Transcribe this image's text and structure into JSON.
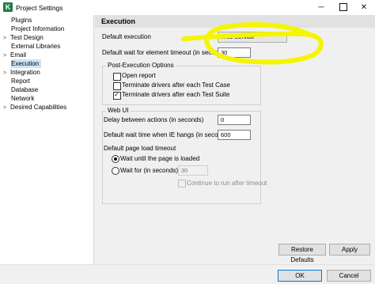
{
  "window": {
    "title": "Project Settings"
  },
  "sidebar": {
    "items": [
      {
        "label": "Plugins"
      },
      {
        "label": "Project Information"
      },
      {
        "label": "Test Design"
      },
      {
        "label": "External Libraries"
      },
      {
        "label": "Email"
      },
      {
        "label": "Execution"
      },
      {
        "label": "Integration"
      },
      {
        "label": "Report"
      },
      {
        "label": "Database"
      },
      {
        "label": "Network"
      },
      {
        "label": "Desired Capabilities"
      }
    ]
  },
  "execution": {
    "title": "Execution",
    "default_execution_label": "Default execution",
    "default_execution_value": "Web Service",
    "default_wait_label": "Default wait for element timeout (in seconds)",
    "default_wait_value": "30",
    "post_execution": {
      "title": "Post-Execution Options",
      "open_report": "Open report",
      "terminate_test_case": "Terminate drivers after each Test Case",
      "terminate_test_suite": "Terminate drivers after each Test Suite"
    },
    "web_ui": {
      "title": "Web UI",
      "delay_label": "Delay between actions (in seconds)",
      "delay_value": "0",
      "ie_wait_label": "Default wait time when IE hangs (in seconds)",
      "ie_wait_value": "600",
      "page_load_label": "Default page load timeout",
      "wait_until_loaded": "Wait until the page is loaded",
      "wait_for_label": "Wait for (in seconds)",
      "wait_for_value": "30",
      "continue_label": "Continue to run after timeout"
    }
  },
  "buttons": {
    "restore_defaults": "Restore Defaults",
    "apply": "Apply",
    "ok": "OK",
    "cancel": "Cancel"
  },
  "annotation_color": "#f5f500"
}
